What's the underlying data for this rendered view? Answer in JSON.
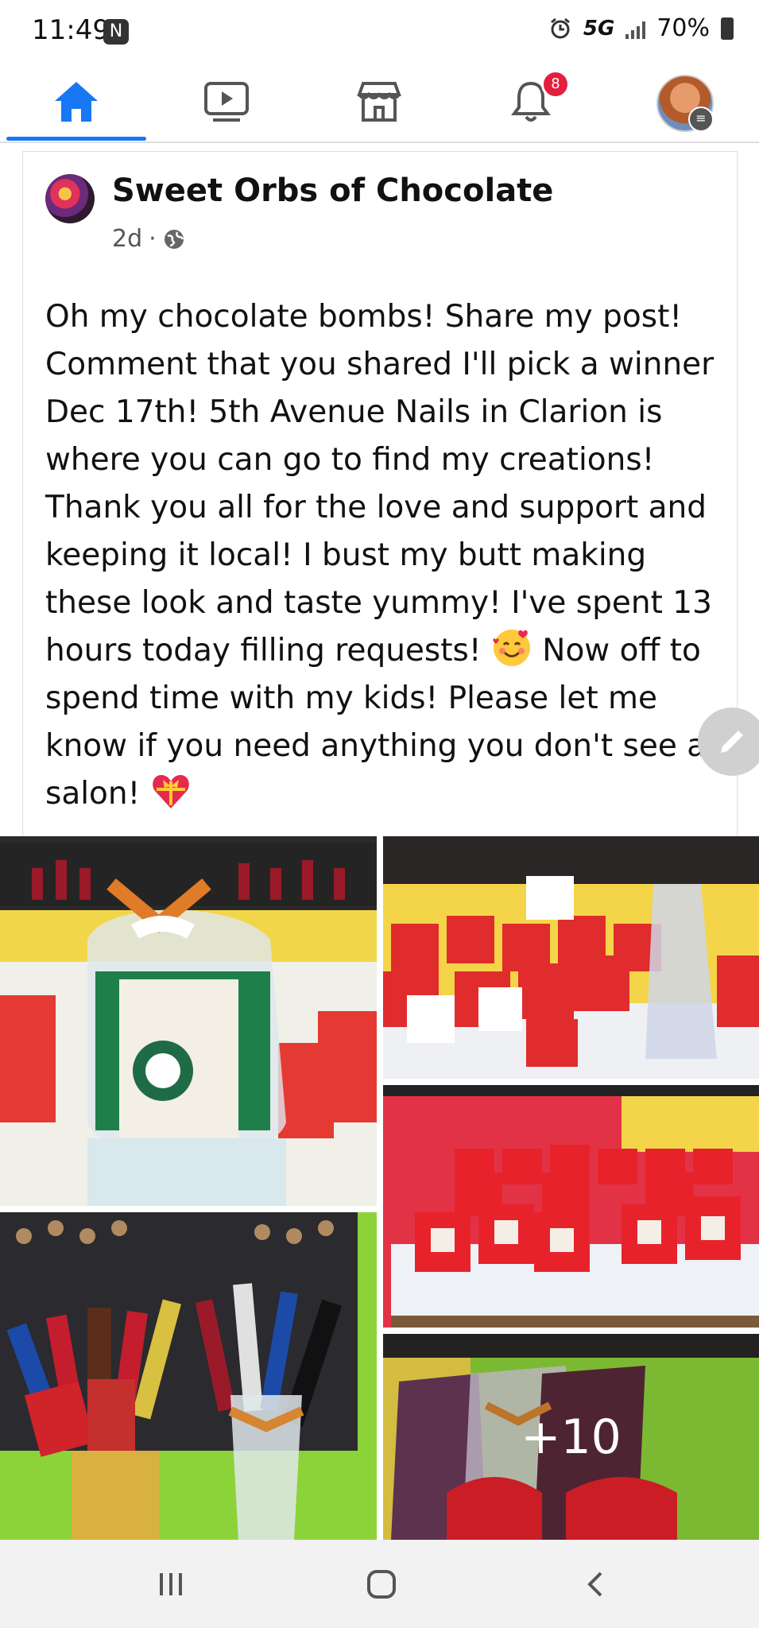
{
  "status_bar": {
    "time": "11:49",
    "network": "5G",
    "battery": "70%"
  },
  "nav": {
    "tabs": [
      {
        "name": "home",
        "active": true
      },
      {
        "name": "watch"
      },
      {
        "name": "marketplace"
      },
      {
        "name": "notifications",
        "badge": "8"
      },
      {
        "name": "profile-menu"
      }
    ],
    "accent": "#1877f2",
    "notification_badge": "8"
  },
  "post": {
    "page_name": "Sweet Orbs of Chocolate",
    "age": "2d",
    "separator": "·",
    "text_before_emoji1": "Oh my chocolate bombs! Share my post! Comment that you shared I'll pick a winner Dec 17th! 5th Avenue Nails in Clarion is where you can go to find my creations! Thank you all for the love and support and keeping it local! I bust my butt making these look and taste yummy! I've spent 13 hours today filling requests! ",
    "text_between_emojis": " Now off to spend time with my kids! Please let me know if you need anything you don't see at salon! ",
    "more_photos": "+10"
  }
}
